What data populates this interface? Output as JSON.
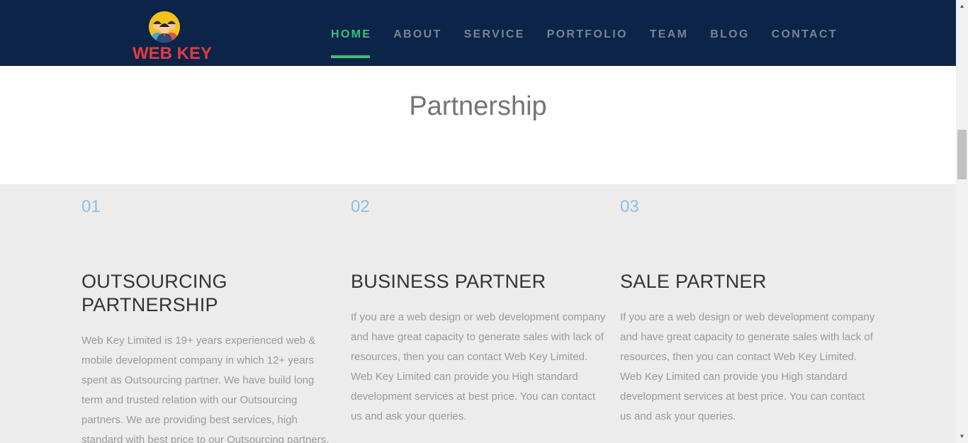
{
  "brand": {
    "name": "WEB KEY",
    "logo_icon": "team-people-icon",
    "name_color": "#e23b42"
  },
  "nav": {
    "items": [
      {
        "label": "HOME",
        "active": true
      },
      {
        "label": "ABOUT",
        "active": false
      },
      {
        "label": "SERVICE",
        "active": false
      },
      {
        "label": "PORTFOLIO",
        "active": false
      },
      {
        "label": "TEAM",
        "active": false
      },
      {
        "label": "BLOG",
        "active": false
      },
      {
        "label": "CONTACT",
        "active": false
      }
    ],
    "active_color": "#39c07a"
  },
  "section": {
    "title": "Partnership",
    "cards": [
      {
        "number": "01",
        "title_line1": "OUTSOURCING",
        "title_line2": "PARTNERSHIP",
        "text": "Web Key Limited is 19+ years experienced web & mobile development company in which 12+ years spent as Outsourcing partner. We have build long term and trusted relation with our Outsourcing partners. We are providing best services, high standard with best price to our Outsourcing partners."
      },
      {
        "number": "02",
        "title_line1": "BUSINESS PARTNER",
        "title_line2": "",
        "text": "If you are a web design or web development company and have great capacity to generate sales with lack of resources, then you can contact Web Key Limited. Web Key Limited can provide you High standard development services at best price. You can contact us and ask your queries."
      },
      {
        "number": "03",
        "title_line1": "SALE PARTNER",
        "title_line2": "",
        "text": "If you are a web design or web development company and have great capacity to generate sales with lack of resources, then you can contact Web Key Limited. Web Key Limited can provide you High standard development services at best price. You can contact us and ask your queries."
      }
    ]
  },
  "colors": {
    "header_bg": "#0b2447",
    "section_bg": "#ececec",
    "number_color": "#8dbde6"
  }
}
